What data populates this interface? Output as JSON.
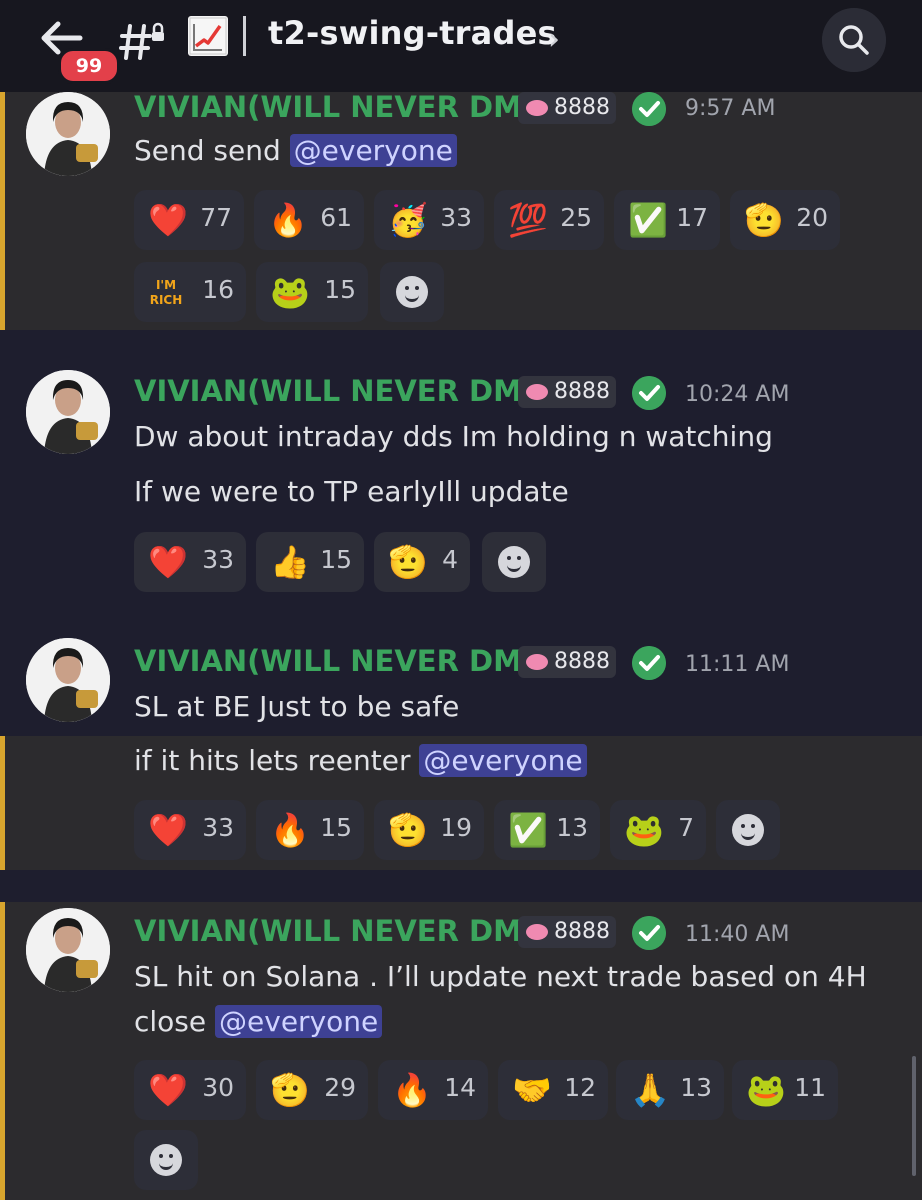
{
  "header": {
    "back_badge": "99",
    "channel_name": "t2-swing-trades",
    "channel_emoji": "📈"
  },
  "messages": [
    {
      "author": "VIVIAN(WILL NEVER DM)",
      "boost": "8888",
      "time": "9:57 AM",
      "lines": [
        {
          "text": "Send send ",
          "mention": "@everyone"
        }
      ],
      "reactions": [
        {
          "emoji": "❤️",
          "count": "77"
        },
        {
          "emoji": "🔥",
          "count": "61"
        },
        {
          "emoji": "🥳",
          "count": "33"
        },
        {
          "emoji": "💯",
          "count": "25"
        },
        {
          "emoji": "✅",
          "count": "17"
        },
        {
          "emoji": "🫡",
          "count": "20"
        },
        {
          "emoji": "I'M RICH",
          "count": "16"
        },
        {
          "emoji": "🐸",
          "count": "15"
        }
      ]
    },
    {
      "author": "VIVIAN(WILL NEVER DM)",
      "boost": "8888",
      "time": "10:24 AM",
      "lines": [
        {
          "text": "Dw about intraday dds Im holding n watching"
        },
        {
          "text": "If we were to TP earlyIll update"
        }
      ],
      "reactions": [
        {
          "emoji": "❤️",
          "count": "33"
        },
        {
          "emoji": "👍",
          "count": "15"
        },
        {
          "emoji": "🫡",
          "count": "4"
        }
      ]
    },
    {
      "author": "VIVIAN(WILL NEVER DM)",
      "boost": "8888",
      "time": "11:11 AM",
      "lines": [
        {
          "text": "SL at BE Just to be safe"
        },
        {
          "text": "if it hits lets reenter ",
          "mention": "@everyone"
        }
      ],
      "reactions": [
        {
          "emoji": "❤️",
          "count": "33"
        },
        {
          "emoji": "🔥",
          "count": "15"
        },
        {
          "emoji": "🫡",
          "count": "19"
        },
        {
          "emoji": "✅",
          "count": "13"
        },
        {
          "emoji": "🐸",
          "count": "7"
        }
      ]
    },
    {
      "author": "VIVIAN(WILL NEVER DM)",
      "boost": "8888",
      "time": "11:40 AM",
      "lines": [
        {
          "text": "SL hit on Solana . I’ll update next trade based on 4H"
        },
        {
          "text": "close ",
          "mention": "@everyone"
        }
      ],
      "reactions": [
        {
          "emoji": "❤️",
          "count": "30"
        },
        {
          "emoji": "🫡",
          "count": "29"
        },
        {
          "emoji": "🔥",
          "count": "14"
        },
        {
          "emoji": "🤝",
          "count": "12"
        },
        {
          "emoji": "🙏",
          "count": "13"
        },
        {
          "emoji": "🐸",
          "count": "11"
        }
      ]
    }
  ],
  "colors": {
    "username": "#3ba55d",
    "mention_bg": "#3e4194",
    "highlight_bar": "#d8a52e",
    "badge": "#e3404a"
  }
}
